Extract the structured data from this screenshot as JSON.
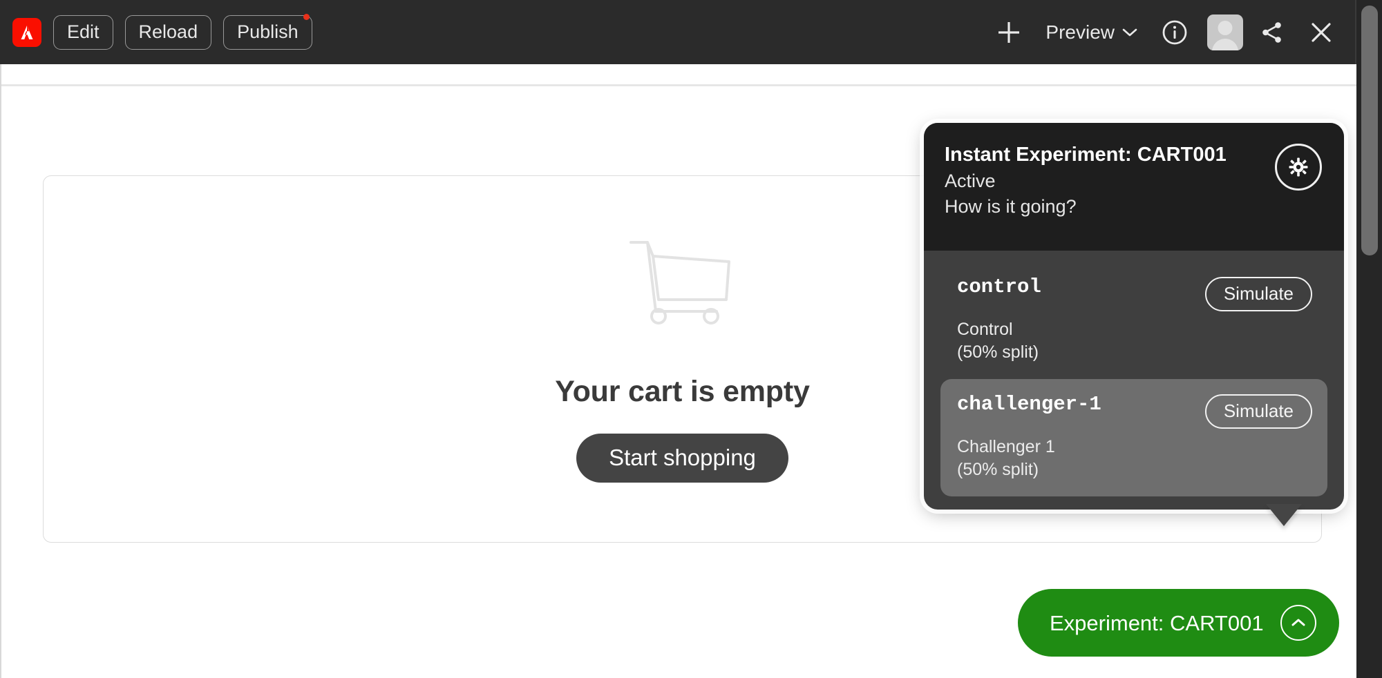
{
  "toolbar": {
    "logo_icon": "adobe-logo-icon",
    "buttons": [
      {
        "label": "Edit",
        "name": "edit-button",
        "badge": false
      },
      {
        "label": "Reload",
        "name": "reload-button",
        "badge": false
      },
      {
        "label": "Publish",
        "name": "publish-button",
        "badge": true
      }
    ],
    "add_icon": "plus-icon",
    "preview_label": "Preview",
    "preview_caret_icon": "chevron-down-icon",
    "info_icon": "info-circle-icon",
    "avatar_icon": "user-avatar-icon",
    "share_icon": "share-icon",
    "close_icon": "close-icon",
    "background_color": "#2b2b2b"
  },
  "cart": {
    "icon": "shopping-cart-icon",
    "title": "Your cart is empty",
    "cta_label": "Start shopping",
    "cta_color": "#444444"
  },
  "experiment_panel": {
    "title": "Instant Experiment: CART001",
    "status": "Active",
    "question": "How is it going?",
    "settings_icon": "gear-icon",
    "header_color": "#1e1e1e",
    "body_color": "#3f3f3f",
    "variants": [
      {
        "key": "control",
        "description": "Control",
        "split": "(50% split)",
        "action_label": "Simulate",
        "highlighted": false
      },
      {
        "key": "challenger-1",
        "description": "Challenger 1",
        "split": "(50% split)",
        "action_label": "Simulate",
        "highlighted": true
      }
    ]
  },
  "experiment_pill": {
    "label": "Experiment: CART001",
    "toggle_icon": "chevron-up-circle-icon",
    "color": "#1f8c13"
  }
}
